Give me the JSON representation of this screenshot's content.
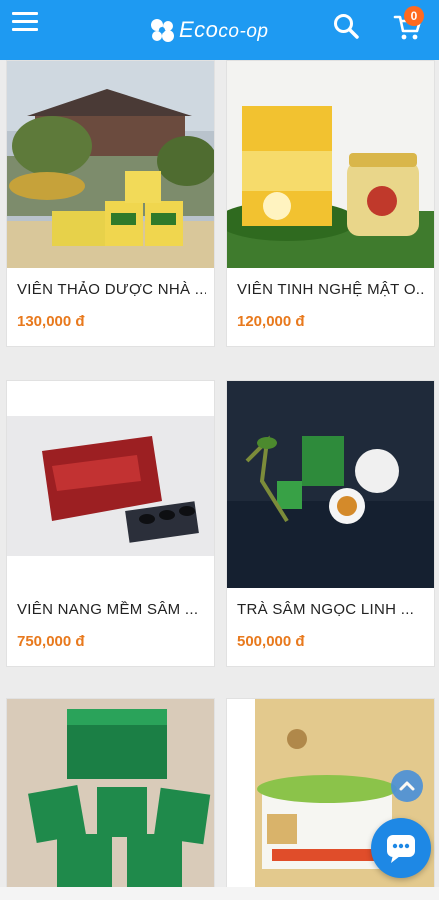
{
  "header": {
    "logo_main": "Eco",
    "logo_sub": "co-op",
    "cart_count": "0",
    "icons": {
      "menu": "menu-icon",
      "search": "search-icon",
      "cart": "cart-icon"
    },
    "colors": {
      "bar": "#1e9af2",
      "badge": "#ff6a1f"
    }
  },
  "products": [
    {
      "name": "VIÊN THẢO DƯỢC NHÀ ...",
      "price": "130,000 đ"
    },
    {
      "name": "VIÊN TINH NGHỆ MẬT O...",
      "price": "120,000 đ"
    },
    {
      "name": "VIÊN NANG MỀM SÂM ...",
      "price": "750,000 đ"
    },
    {
      "name": "TRÀ SÂM NGỌC LINH ...",
      "price": "500,000 đ"
    },
    {
      "name": "",
      "price": ""
    },
    {
      "name": "",
      "price": ""
    }
  ],
  "price_color": "#e8791d",
  "floating": {
    "scroll_top": "arrow-up-icon",
    "chat": "chat-icon"
  }
}
